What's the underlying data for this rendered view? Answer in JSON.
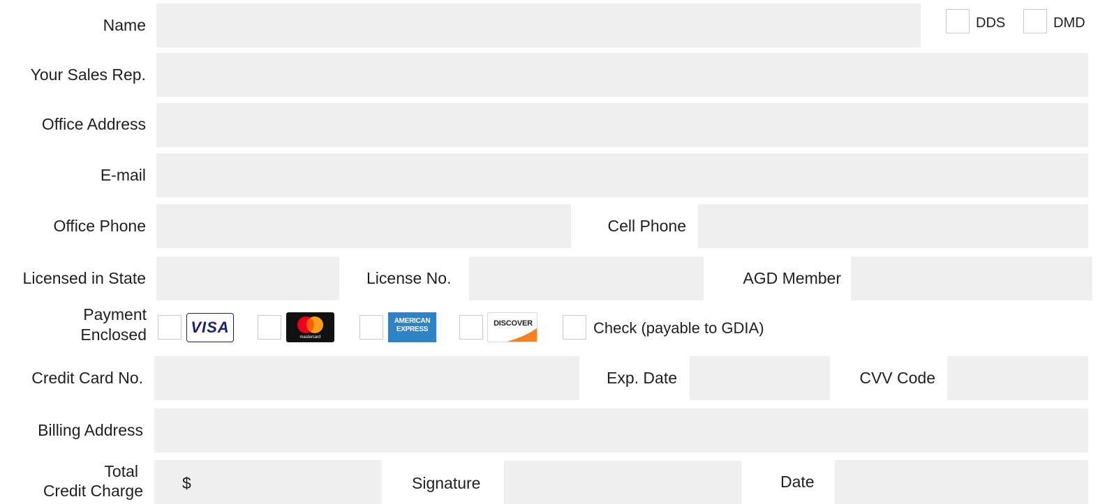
{
  "form": {
    "name_label": "Name",
    "dds_label": "DDS",
    "dmd_label": "DMD",
    "sales_rep_label": "Your Sales Rep.",
    "office_address_label": "Office Address",
    "email_label": "E-mail",
    "office_phone_label": "Office Phone",
    "cell_phone_label": "Cell Phone",
    "licensed_state_label": "Licensed in State",
    "license_no_label": "License No.",
    "agd_member_label": "AGD Member",
    "payment_label_line1": "Payment",
    "payment_label_line2": "Enclosed",
    "visa_text": "VISA",
    "mastercard_text": "mastercard",
    "amex_text_line1": "AMERICAN",
    "amex_text_line2": "EXPRESS",
    "discover_text": "DISCOVER",
    "check_label": "Check (payable to GDIA)",
    "credit_card_label": "Credit Card No.",
    "exp_date_label": "Exp. Date",
    "cvv_label": "CVV Code",
    "billing_address_label": "Billing Address",
    "total_label_line1": "Total",
    "total_label_line2": "Credit Charge",
    "currency_symbol": "$",
    "signature_label": "Signature",
    "date_label": "Date"
  },
  "colors": {
    "field_bg": "#efefef",
    "visa_blue": "#1a1f71",
    "amex_blue": "#2f82c5",
    "discover_orange": "#f58220",
    "mastercard_red": "#eb001b",
    "mastercard_yellow": "#f79e1b"
  }
}
